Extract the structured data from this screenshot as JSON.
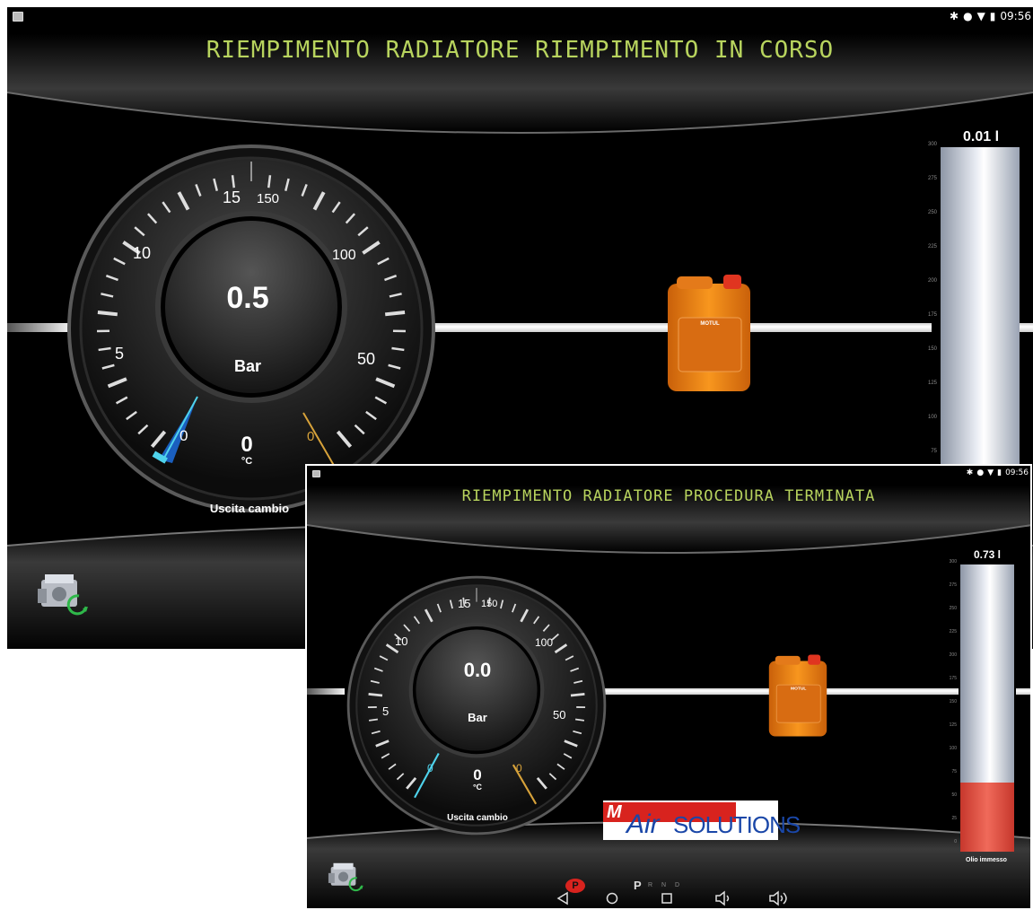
{
  "screen1": {
    "status_time": "09:56",
    "title": "RIEMPIMENTO RADIATORE RIEMPIMENTO IN CORSO",
    "gauge": {
      "pressure_value": "0.5",
      "pressure_unit": "Bar",
      "temp_value": "0",
      "temp_unit": "°C",
      "left_labels": [
        "15",
        "10",
        "5",
        "0"
      ],
      "right_labels": [
        "150",
        "100",
        "50",
        "0"
      ],
      "caption": "Uscita cambio"
    },
    "cylinder": {
      "value_label": "0.01 l",
      "scale": [
        "300",
        "275",
        "250",
        "225",
        "200",
        "175",
        "150",
        "125",
        "100",
        "75"
      ],
      "fill_fraction": 0.0
    },
    "can_brand": "MOTUL"
  },
  "screen2": {
    "status_time": "09:56",
    "title": "RIEMPIMENTO RADIATORE PROCEDURA TERMINATA",
    "gauge": {
      "pressure_value": "0.0",
      "pressure_unit": "Bar",
      "temp_value": "0",
      "temp_unit": "°C",
      "left_labels": [
        "15",
        "10",
        "5",
        "0"
      ],
      "right_labels": [
        "150",
        "100",
        "50",
        "0"
      ],
      "caption": "Uscita cambio"
    },
    "cylinder": {
      "value_label": "0.73 l",
      "scale": [
        "300",
        "275",
        "250",
        "225",
        "200",
        "175",
        "150",
        "125",
        "100",
        "75",
        "50",
        "25",
        "0"
      ],
      "fill_fraction": 0.24,
      "caption": "Olio immesso"
    },
    "can_brand": "MOTUL",
    "logo": {
      "m": "M",
      "air": "Air",
      "solutions": "SOLUTIONS"
    },
    "gear": {
      "park": "P",
      "selected": "P",
      "others": "R N D"
    }
  },
  "colors": {
    "title": "#b8d45e",
    "cold_needle": "#4fd3ec",
    "hot_needle": "#d7a23a",
    "fill": "#e8574a",
    "can": "#f08a1c"
  }
}
